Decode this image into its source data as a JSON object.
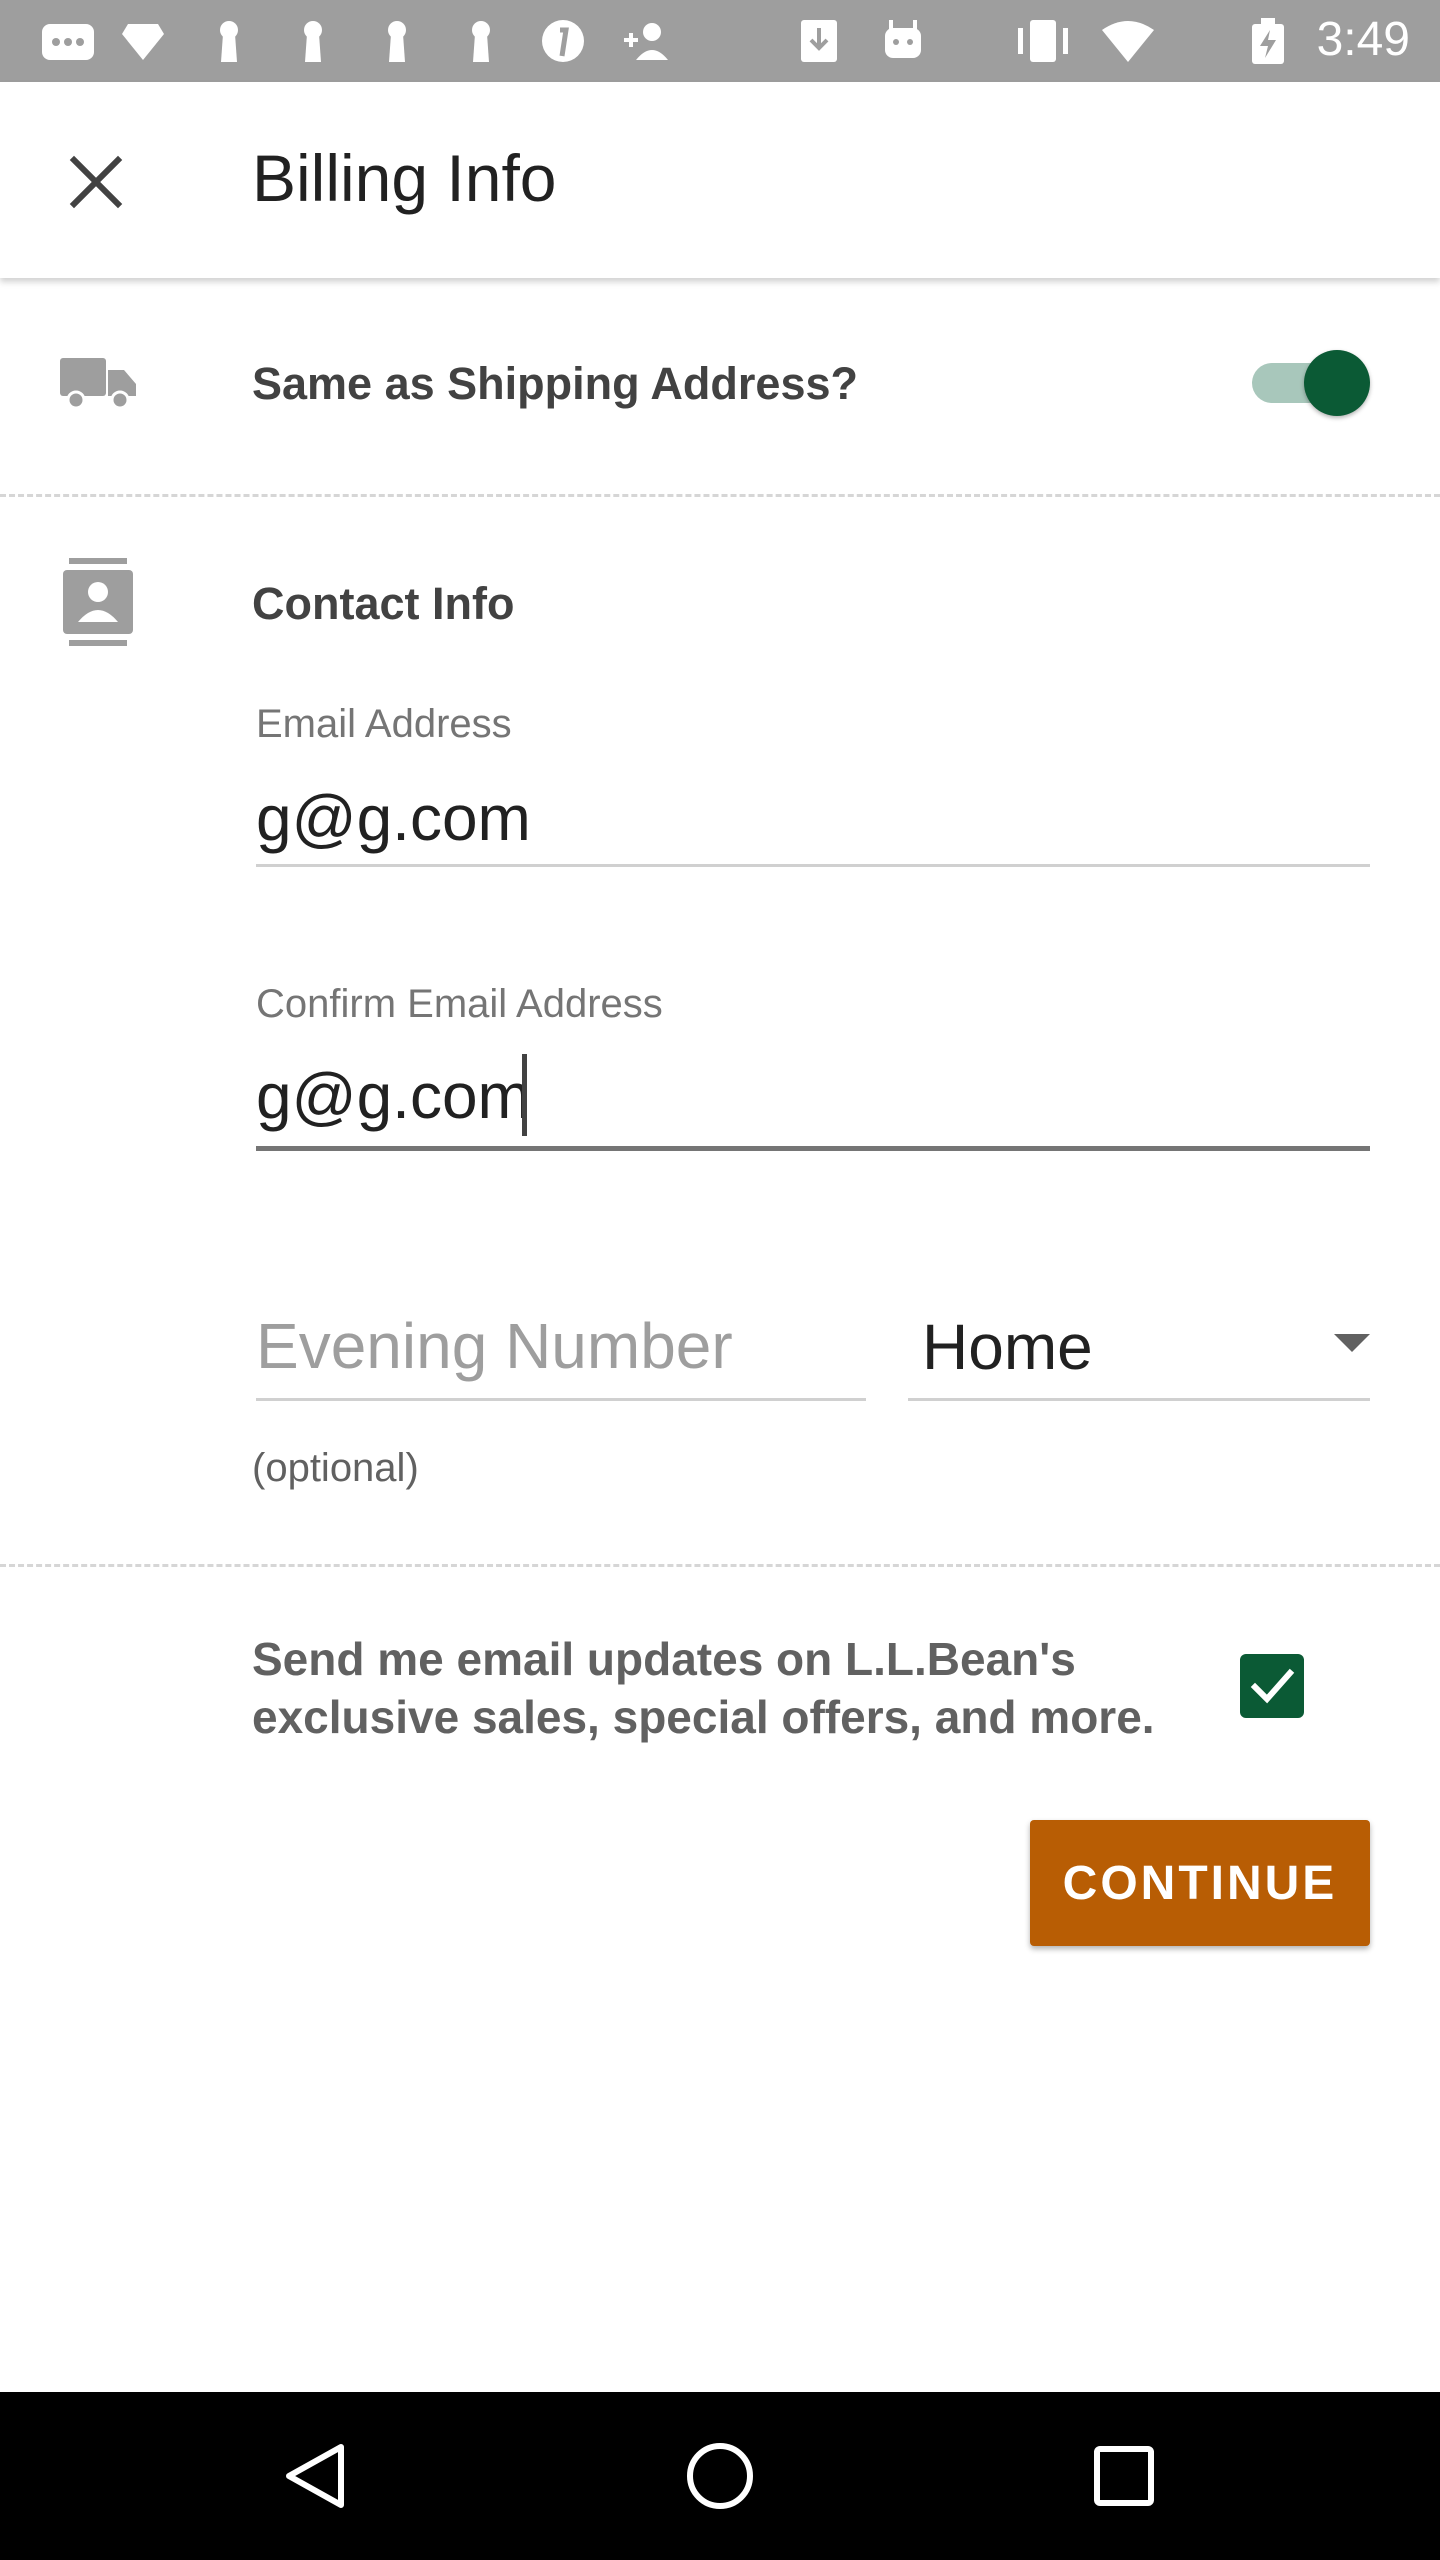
{
  "status_bar": {
    "time": "3:49",
    "icons": [
      "messages-icon",
      "gem-icon",
      "keyhole-icon",
      "keyhole-icon",
      "keyhole-icon",
      "keyhole-icon",
      "pinterest-icon",
      "add-person-icon",
      "download-icon",
      "android-icon",
      "vibrate-icon",
      "wifi-icon",
      "battery-charging-icon"
    ]
  },
  "header": {
    "title": "Billing Info",
    "close_icon": "close-icon"
  },
  "shipping": {
    "icon": "truck-icon",
    "label": "Same as Shipping Address?",
    "toggle_on": true
  },
  "contact": {
    "icon": "contact-card-icon",
    "title": "Contact Info",
    "email": {
      "label": "Email Address",
      "value": "g@g.com"
    },
    "confirm_email": {
      "label": "Confirm Email Address",
      "value": "g@g.com"
    },
    "evening_number": {
      "placeholder": "Evening Number",
      "value": ""
    },
    "phone_type": {
      "selected": "Home"
    },
    "optional_note": "(optional)"
  },
  "promo": {
    "text": "Send me email updates on L.L.Bean's exclusive sales, special offers, and more.",
    "checked": true
  },
  "actions": {
    "continue_label": "CONTINUE"
  },
  "colors": {
    "accent_green": "#0b5a35",
    "button_orange": "#b85d04",
    "status_bar": "#9e9e9e"
  },
  "nav_bar": {
    "icons": [
      "back-icon",
      "home-icon",
      "recents-icon"
    ]
  }
}
